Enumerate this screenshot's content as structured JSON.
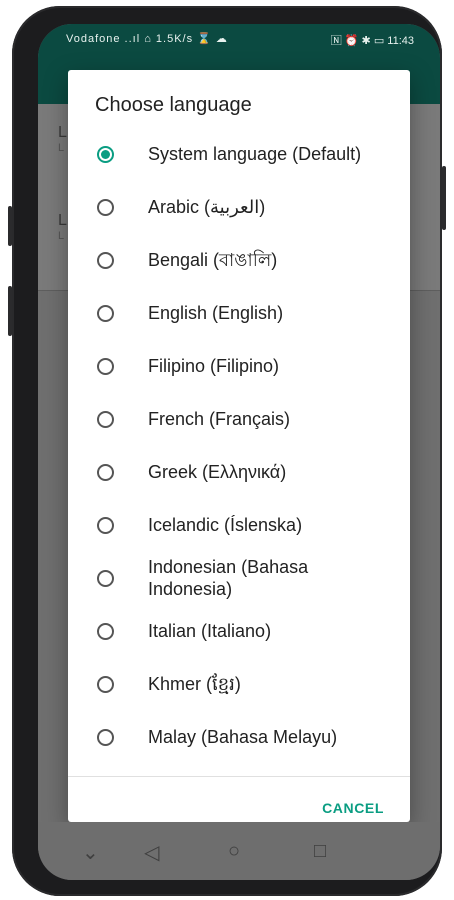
{
  "status_bar": {
    "left": "Vodafone ..ıl ⌂ 1.5K/s ⌛ ☁",
    "right": "🄽 ⏰ ✱ ▭ 11:43"
  },
  "dialog": {
    "title": "Choose language",
    "options": [
      {
        "label": "System language (Default)",
        "selected": true
      },
      {
        "label": "Arabic (العربية)",
        "selected": false
      },
      {
        "label": "Bengali (বাঙালি)",
        "selected": false
      },
      {
        "label": "English (English)",
        "selected": false
      },
      {
        "label": "Filipino (Filipino)",
        "selected": false
      },
      {
        "label": "French (Français)",
        "selected": false
      },
      {
        "label": "Greek (Ελληνικά)",
        "selected": false
      },
      {
        "label": "Icelandic (Íslenska)",
        "selected": false
      },
      {
        "label": "Indonesian (Bahasa Indonesia)",
        "selected": false
      },
      {
        "label": "Italian (Italiano)",
        "selected": false
      },
      {
        "label": "Khmer (ខ្មែរ)",
        "selected": false
      },
      {
        "label": "Malay (Bahasa Melayu)",
        "selected": false
      }
    ],
    "cancel_label": "CANCEL"
  },
  "background": {
    "row1_title": "L",
    "row1_sub": "L",
    "row2_title": "L",
    "row2_sub": "L"
  },
  "nav": {
    "down": "⌄",
    "back": "◁",
    "home": "○",
    "recents": "□"
  },
  "colors": {
    "accent": "#0a9d82",
    "app_bar": "#0b4a41"
  }
}
